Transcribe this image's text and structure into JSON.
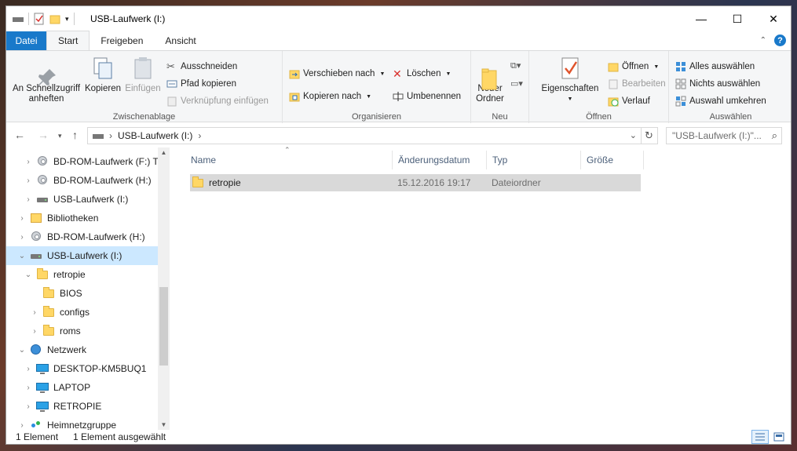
{
  "window": {
    "title": "USB-Laufwerk (I:)",
    "minimize_glyph": "—",
    "maximize_glyph": "☐",
    "close_glyph": "✕"
  },
  "tabs": [
    {
      "label": "Datei"
    },
    {
      "label": "Start"
    },
    {
      "label": "Freigeben"
    },
    {
      "label": "Ansicht"
    }
  ],
  "ribbon": {
    "clipboard": {
      "label": "Zwischenablage",
      "pin": "An Schnellzugriff\nanheften",
      "copy": "Kopieren",
      "paste": "Einfügen",
      "cut": "Ausschneiden",
      "copy_path": "Pfad kopieren",
      "paste_shortcut": "Verknüpfung einfügen"
    },
    "organize": {
      "label": "Organisieren",
      "move_to": "Verschieben nach",
      "copy_to": "Kopieren nach",
      "delete": "Löschen",
      "rename": "Umbenennen"
    },
    "new": {
      "label": "Neu",
      "new_folder": "Neuer\nOrdner"
    },
    "open": {
      "label": "Öffnen",
      "properties": "Eigenschaften",
      "open": "Öffnen",
      "edit": "Bearbeiten",
      "history": "Verlauf"
    },
    "select": {
      "label": "Auswählen",
      "select_all": "Alles auswählen",
      "select_none": "Nichts auswählen",
      "invert": "Auswahl umkehren"
    }
  },
  "address": {
    "crumb": "USB-Laufwerk (I:)",
    "search_placeholder": "\"USB-Laufwerk (I:)\"..."
  },
  "tree": [
    {
      "label": "BD-ROM-Laufwerk (F:) Ta",
      "icon": "disc-drive-icon",
      "indent": 2,
      "expanded": false
    },
    {
      "label": "BD-ROM-Laufwerk (H:)",
      "icon": "disc-icon",
      "indent": 2,
      "expanded": false
    },
    {
      "label": "USB-Laufwerk (I:)",
      "icon": "usb-drive-icon",
      "indent": 2,
      "expanded": false
    },
    {
      "label": "Bibliotheken",
      "icon": "libraries-icon",
      "indent": 1,
      "expanded": false
    },
    {
      "label": "BD-ROM-Laufwerk (H:)",
      "icon": "disc-icon",
      "indent": 1,
      "expanded": false
    },
    {
      "label": "USB-Laufwerk (I:)",
      "icon": "usb-drive-icon",
      "indent": 1,
      "expanded": true,
      "selected": true
    },
    {
      "label": "retropie",
      "icon": "folder-icon",
      "indent": 2,
      "expanded": true
    },
    {
      "label": "BIOS",
      "icon": "folder-icon",
      "indent": 3,
      "expanded": null
    },
    {
      "label": "configs",
      "icon": "folder-icon",
      "indent": 3,
      "expanded": false
    },
    {
      "label": "roms",
      "icon": "folder-icon",
      "indent": 3,
      "expanded": false
    },
    {
      "label": "Netzwerk",
      "icon": "network-icon",
      "indent": 1,
      "expanded": true
    },
    {
      "label": "DESKTOP-KM5BUQ1",
      "icon": "computer-icon",
      "indent": 2,
      "expanded": false
    },
    {
      "label": "LAPTOP",
      "icon": "computer-icon",
      "indent": 2,
      "expanded": false
    },
    {
      "label": "RETROPIE",
      "icon": "computer-icon",
      "indent": 2,
      "expanded": false
    },
    {
      "label": "Heimnetzgruppe",
      "icon": "homegroup-icon",
      "indent": 1,
      "expanded": false
    }
  ],
  "columns": {
    "name": "Name",
    "modified": "Änderungsdatum",
    "type": "Typ",
    "size": "Größe"
  },
  "files": [
    {
      "name": "retropie",
      "modified": "15.12.2016 19:17",
      "type": "Dateiordner",
      "size": ""
    }
  ],
  "status": {
    "count": "1 Element",
    "selected": "1 Element ausgewählt"
  }
}
